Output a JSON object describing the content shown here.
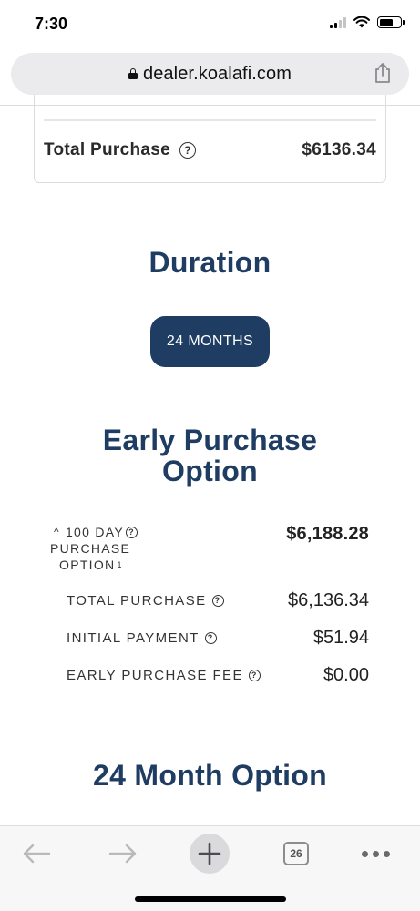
{
  "status_bar": {
    "time": "7:30"
  },
  "address_bar": {
    "url": "dealer.koalafi.com"
  },
  "summary": {
    "total_purchase_label": "Total Purchase",
    "total_purchase_value": "$6136.34"
  },
  "duration": {
    "heading": "Duration",
    "selected_option": "24 MONTHS"
  },
  "early_purchase": {
    "heading_line1": "Early Purchase",
    "heading_line2": "Option",
    "option_line1": "100 DAY",
    "option_line2": "PURCHASE",
    "option_line3": "OPTION",
    "option_superscript": "1",
    "option_total": "$6,188.28",
    "rows": [
      {
        "label": "TOTAL PURCHASE",
        "value": "$6,136.34"
      },
      {
        "label": "INITIAL PAYMENT",
        "value": "$51.94"
      },
      {
        "label": "EARLY PURCHASE FEE",
        "value": "$0.00"
      }
    ]
  },
  "month_option": {
    "heading": "24 Month Option"
  },
  "toolbar": {
    "tab_count": "26"
  },
  "colors": {
    "primary": "#1f3d63",
    "address_bar_bg": "#ebebed"
  },
  "icons": {
    "help": "question-circle-icon",
    "back": "arrow-left-icon",
    "forward": "arrow-right-icon",
    "new_tab": "plus-icon",
    "tabs": "tabs-icon",
    "more": "more-dots-icon",
    "share": "share-icon",
    "lock": "lock-icon"
  }
}
